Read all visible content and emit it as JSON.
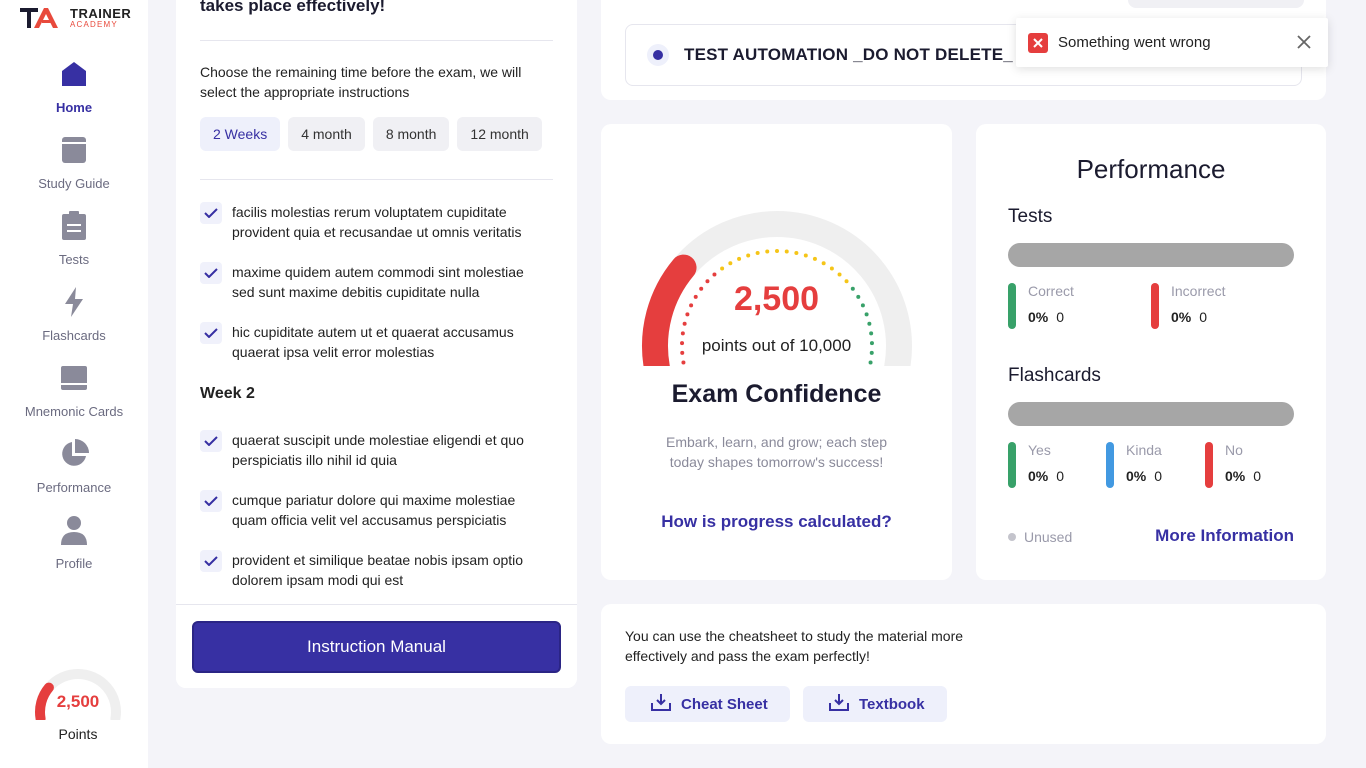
{
  "brand": {
    "line1": "TRAINER",
    "line2": "ACADEMY"
  },
  "sidebar": {
    "items": [
      {
        "label": "Home",
        "icon": "home-icon"
      },
      {
        "label": "Study Guide",
        "icon": "book-icon"
      },
      {
        "label": "Tests",
        "icon": "clipboard-icon"
      },
      {
        "label": "Flashcards",
        "icon": "lightning-icon"
      },
      {
        "label": "Mnemonic Cards",
        "icon": "card-icon"
      },
      {
        "label": "Performance",
        "icon": "pie-chart-icon"
      },
      {
        "label": "Profile",
        "icon": "user-icon"
      }
    ],
    "points": {
      "value": "2,500",
      "label": "Points",
      "max": 10000,
      "current": 2500
    }
  },
  "plan": {
    "title": "takes place effectively!",
    "description": "Choose the remaining time before the exam, we will select the appropriate instructions",
    "time_options": [
      "2 Weeks",
      "4 month",
      "8 month",
      "12 month"
    ],
    "selected_time": "2 Weeks",
    "tasks_week1": [
      "facilis molestias rerum voluptatem cupiditate provident quia et recusandae ut omnis veritatis",
      "maxime quidem autem commodi sint molestiae sed sunt maxime debitis cupiditate nulla",
      "hic cupiditate autem ut et quaerat accusamus quaerat ipsa velit error molestias"
    ],
    "week2_title": "Week 2",
    "tasks_week2": [
      "quaerat suscipit unde molestiae eligendi et quo perspiciatis illo nihil id quia",
      "cumque pariatur dolore qui maxime molestiae quam officia velit vel accusamus perspiciatis",
      "provident et similique beatae nobis ipsam optio dolorem ipsam modi qui est"
    ],
    "manual_button": "Instruction Manual"
  },
  "course": {
    "name": "TEST AUTOMATION _DO NOT DELETE_"
  },
  "confidence": {
    "value": "2,500",
    "current": 2500,
    "max": 10000,
    "subtitle": "points out of 10,000",
    "title": "Exam Confidence",
    "description": "Embark, learn, and grow; each step today shapes tomorrow's success!",
    "link": "How is progress calculated?",
    "colors": {
      "progress": "#e53e3e",
      "track": "#efefef",
      "dots_low": "#e53e3e",
      "dots_mid": "#f5c518",
      "dots_high": "#38a169"
    }
  },
  "performance": {
    "title": "Performance",
    "tests": {
      "title": "Tests",
      "stats": [
        {
          "label": "Correct",
          "percent": "0%",
          "count": "0",
          "color": "#38a169"
        },
        {
          "label": "Incorrect",
          "percent": "0%",
          "count": "0",
          "color": "#e53e3e"
        }
      ]
    },
    "flashcards": {
      "title": "Flashcards",
      "stats": [
        {
          "label": "Yes",
          "percent": "0%",
          "count": "0",
          "color": "#38a169"
        },
        {
          "label": "Kinda",
          "percent": "0%",
          "count": "0",
          "color": "#4299e1"
        },
        {
          "label": "No",
          "percent": "0%",
          "count": "0",
          "color": "#e53e3e"
        }
      ]
    },
    "unused_label": "Unused",
    "more_info": "More Information"
  },
  "cheatsheet": {
    "description": "You can use the cheatsheet to study the material more effectively and pass the exam perfectly!",
    "buttons": [
      "Cheat Sheet",
      "Textbook"
    ]
  },
  "toast": {
    "message": "Something went wrong"
  },
  "colors": {
    "accent": "#3730a3",
    "danger": "#e53e3e",
    "success": "#38a169"
  }
}
